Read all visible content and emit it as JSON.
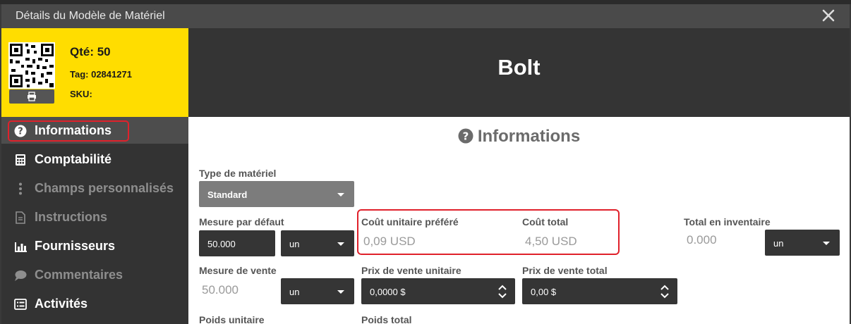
{
  "window": {
    "title": "Détails du Modèle de Matériel"
  },
  "summary": {
    "qty": "Qté: 50",
    "tag": "Tag: 02841271",
    "sku": "SKU:"
  },
  "header": {
    "name": "Bolt"
  },
  "sidebar": {
    "items": [
      {
        "label": "Informations",
        "icon": "question-circle-icon",
        "state": "active"
      },
      {
        "label": "Comptabilité",
        "icon": "calculator-icon",
        "state": "enabled"
      },
      {
        "label": "Champs personnalisés",
        "icon": "vertical-ellipsis-icon",
        "state": "disabled"
      },
      {
        "label": "Instructions",
        "icon": "document-icon",
        "state": "disabled"
      },
      {
        "label": "Fournisseurs",
        "icon": "bar-chart-icon",
        "state": "enabled"
      },
      {
        "label": "Commentaires",
        "icon": "comment-icon",
        "state": "disabled"
      },
      {
        "label": "Activités",
        "icon": "list-icon",
        "state": "enabled"
      }
    ]
  },
  "section": {
    "title": "Informations"
  },
  "form": {
    "type": {
      "label": "Type de matériel",
      "value": "Standard"
    },
    "default_measure": {
      "label": "Mesure par défaut",
      "value": "50.000",
      "unit": "un"
    },
    "unit_cost": {
      "label": "Coût unitaire préféré",
      "value": "0,09 USD"
    },
    "total_cost": {
      "label": "Coût total",
      "value": "4,50 USD"
    },
    "inventory_total": {
      "label": "Total en inventaire",
      "value": "0.000",
      "unit": "un"
    },
    "sale_measure": {
      "label": "Mesure de vente",
      "value": "50.000",
      "unit": "un"
    },
    "unit_sale_price": {
      "label": "Prix de vente unitaire",
      "value": "0,0000 $"
    },
    "total_sale_price": {
      "label": "Prix de vente total",
      "value": "0,00 $"
    },
    "unit_weight": {
      "label": "Poids unitaire"
    },
    "total_weight": {
      "label": "Poids total"
    }
  },
  "colors": {
    "accent_yellow": "#ffdd00",
    "highlight_red": "#e0212b",
    "dark": "#333333"
  }
}
